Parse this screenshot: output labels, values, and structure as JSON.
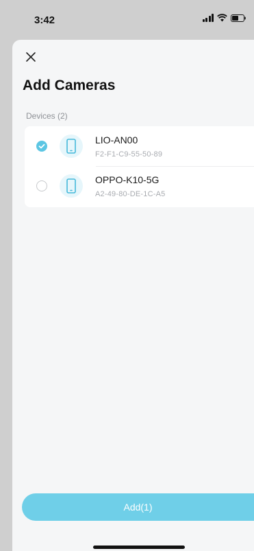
{
  "status_bar": {
    "time": "3:42",
    "icons": [
      "signal-icon",
      "wifi-icon",
      "battery-icon"
    ]
  },
  "header": {
    "close_icon": "close-icon",
    "title": "Add Cameras"
  },
  "devices_section": {
    "label": "Devices (2)",
    "items": [
      {
        "name": "LIO-AN00",
        "mac": "F2-F1-C9-55-50-89",
        "selected": true,
        "icon": "phone-icon"
      },
      {
        "name": "OPPO-K10-5G",
        "mac": "A2-49-80-DE-1C-A5",
        "selected": false,
        "icon": "phone-icon"
      }
    ]
  },
  "footer": {
    "add_label": "Add(1)"
  },
  "colors": {
    "accent": "#5cc6e3",
    "button": "#6fcfe8",
    "icon_bg": "#e6f6fb",
    "sheet_bg": "#f5f6f7",
    "backdrop": "#cfcfcf"
  }
}
